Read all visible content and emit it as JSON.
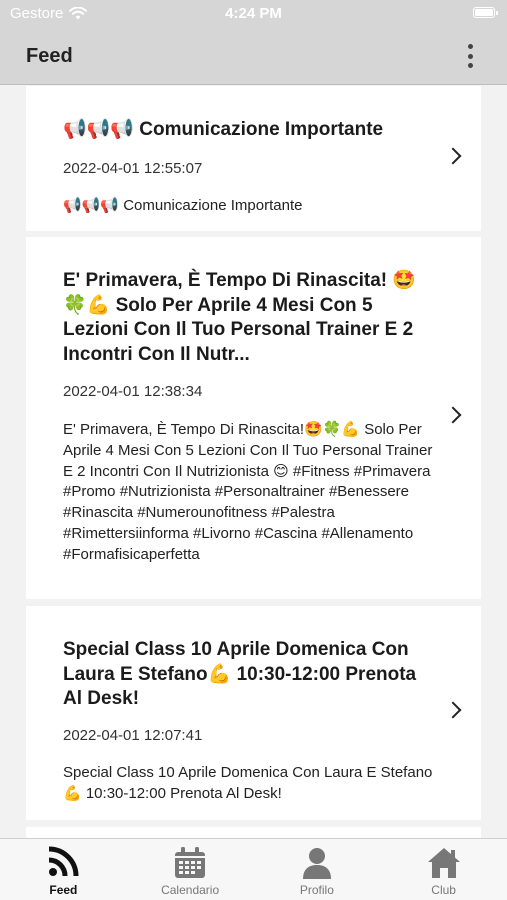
{
  "status_bar": {
    "carrier": "Gestore",
    "time": "4:24 PM"
  },
  "header": {
    "title": "Feed"
  },
  "feed": {
    "cards": [
      {
        "title": "📢📢📢 Comunicazione Importante",
        "date": "2022-04-01 12:55:07",
        "body": "📢📢📢 Comunicazione Importante"
      },
      {
        "title": "E' Primavera, È Tempo Di Rinascita! 🤩🍀💪 Solo Per Aprile 4 Mesi Con 5 Lezioni Con Il Tuo Personal Trainer E 2 Incontri Con Il Nutr...",
        "date": "2022-04-01 12:38:34",
        "body": "E' Primavera, È Tempo Di Rinascita!🤩🍀💪 Solo Per Aprile 4 Mesi Con 5 Lezioni Con Il Tuo Personal Trainer E 2 Incontri Con Il Nutrizionista 😊 #Fitness #Primavera #Promo #Nutrizionista #Personaltrainer #Benessere #Rinascita #Numerounofitness #Palestra #Rimettersiinforma #Livorno #Cascina #Allenamento #Formafisicaperfetta"
      },
      {
        "title": "Special Class 10 Aprile Domenica Con Laura E Stefano💪 10:30-12:00 Prenota Al Desk!",
        "date": "2022-04-01 12:07:41",
        "body": "Special Class 10 Aprile Domenica Con Laura E Stefano💪 10:30-12:00 Prenota Al Desk!"
      }
    ]
  },
  "tabs": [
    {
      "label": "Feed",
      "icon": "rss-icon",
      "active": true
    },
    {
      "label": "Calendario",
      "icon": "calendar-icon",
      "active": false
    },
    {
      "label": "Profilo",
      "icon": "user-icon",
      "active": false
    },
    {
      "label": "Club",
      "icon": "home-icon",
      "active": false
    }
  ],
  "colors": {
    "header_bg": "#d6d6d6",
    "active_tab": "#111111",
    "inactive_tab": "#777777"
  }
}
